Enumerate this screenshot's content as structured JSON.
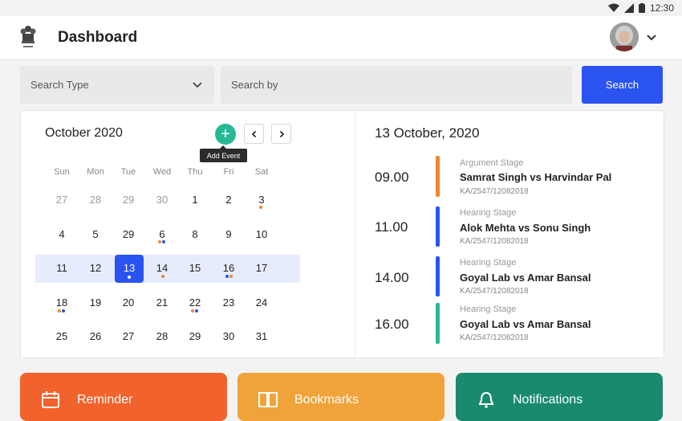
{
  "status_bar": {
    "time": "12:30"
  },
  "header": {
    "title": "Dashboard",
    "profile_icon": "chevron-down-icon"
  },
  "search": {
    "type_placeholder": "Search Type",
    "by_placeholder": "Search by",
    "button_label": "Search",
    "accent": "#2a53f0"
  },
  "calendar": {
    "month_label": "October 2020",
    "add_tooltip": "Add Event",
    "weekdays": [
      "Sun",
      "Mon",
      "Tue",
      "Wed",
      "Thu",
      "Fri",
      "Sat"
    ],
    "weeks": [
      [
        "27",
        "28",
        "29",
        "30",
        "1",
        "2",
        "3"
      ],
      [
        "4",
        "5",
        "29",
        "6",
        "8",
        "9",
        "10"
      ],
      [
        "11",
        "12",
        "13",
        "14",
        "15",
        "16",
        "17"
      ],
      [
        "18",
        "19",
        "20",
        "21",
        "22",
        "23",
        "24"
      ],
      [
        "25",
        "26",
        "27",
        "28",
        "29",
        "30",
        "31"
      ]
    ],
    "selected_day": "13",
    "highlight_color": "#e7ecfd"
  },
  "schedule": {
    "date_label": "13 October, 2020",
    "events": [
      {
        "time": "09.00",
        "stage": "Argument Stage",
        "case": "Samrat Singh vs Harvindar Pal",
        "number": "KA/2547/12082018",
        "color": "#f0862b"
      },
      {
        "time": "11.00",
        "stage": "Hearing Stage",
        "case": "Alok Mehta vs Sonu Singh",
        "number": "KA/2547/12082018",
        "color": "#2a53f0"
      },
      {
        "time": "14.00",
        "stage": "Hearing Stage",
        "case": "Goyal Lab vs Amar Bansal",
        "number": "KA/2547/12082018",
        "color": "#2a53f0"
      },
      {
        "time": "16.00",
        "stage": "Hearing Stage",
        "case": "Goyal Lab vs Amar Bansal",
        "number": "KA/2547/12082018",
        "color": "#27b995"
      }
    ]
  },
  "cards": [
    {
      "label": "Reminder",
      "icon": "calendar-icon",
      "color": "#f2622c"
    },
    {
      "label": "Bookmarks",
      "icon": "book-icon",
      "color": "#f0a33a"
    },
    {
      "label": "Notifications",
      "icon": "bell-icon",
      "color": "#198a6d"
    }
  ]
}
